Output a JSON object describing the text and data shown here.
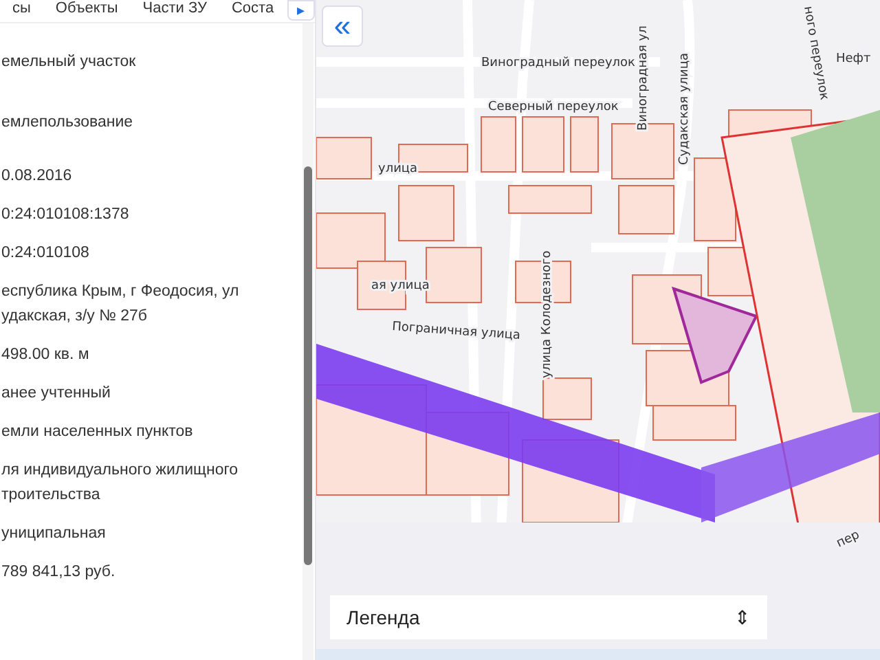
{
  "tabs": [
    {
      "label": "сы",
      "selected": false
    },
    {
      "label": "Объекты",
      "selected": false
    },
    {
      "label": "Части ЗУ",
      "selected": false
    },
    {
      "label": "Соста",
      "selected": false
    }
  ],
  "tab_scroll": {
    "icon": "▸"
  },
  "fields": [
    "емельный участок",
    "емлепользование",
    "0.08.2016",
    "0:24:010108:1378",
    "0:24:010108",
    "еспублика Крым, г Феодосия, ул удакская, з/у № 27б",
    "498.00 кв. м",
    "анее учтенный",
    "емли населенных пунктов",
    "ля индивидуального жилищного троительства",
    "униципальная",
    "789 841,13 руб."
  ],
  "map": {
    "collapse_button": "«",
    "labels": [
      "Виноградный переулок",
      "Северный переулок",
      "Виноградная ул",
      "Судакская улица",
      "улица Колодезного",
      "Пограничная улица",
      "ая улица",
      "улица",
      "ного переулок",
      "Нефт",
      "пер"
    ],
    "legend": {
      "label": "Легенда",
      "icon": "⇕"
    }
  }
}
